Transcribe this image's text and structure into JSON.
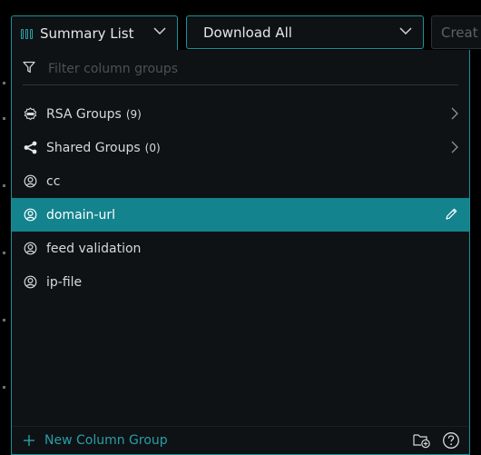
{
  "toolbar": {
    "summary_label": "Summary List",
    "download_label": "Download All",
    "create_label": "Creat"
  },
  "filter": {
    "placeholder": "Filter column groups",
    "value": ""
  },
  "groups": [
    {
      "label": "RSA Groups",
      "count": "(9)",
      "icon": "rsa-live-icon",
      "has_submenu": true
    },
    {
      "label": "Shared Groups",
      "count": "(0)",
      "icon": "share-icon",
      "has_submenu": true
    },
    {
      "label": "cc",
      "icon": "user-circle-icon"
    },
    {
      "label": "domain-url",
      "icon": "user-circle-icon",
      "active": true
    },
    {
      "label": "feed validation",
      "icon": "user-circle-icon"
    },
    {
      "label": "ip-file",
      "icon": "user-circle-icon"
    }
  ],
  "footer": {
    "new_label": "New Column Group"
  },
  "colors": {
    "accent": "#1f8e96",
    "active_row": "#13838d",
    "link": "#2a9ea7",
    "panel_bg": "#0e1215"
  }
}
